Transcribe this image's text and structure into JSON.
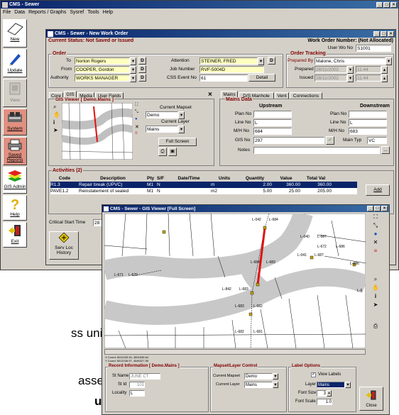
{
  "app": {
    "title": "CMS - Sewer",
    "menu": [
      "File",
      "Data",
      "Reports / Graphs",
      "Sysref",
      "Tools",
      "Help"
    ],
    "window_buttons": [
      "_",
      "□",
      "×"
    ]
  },
  "nav": [
    {
      "label": "New",
      "icon": "blank-document-icon"
    },
    {
      "label": "Update",
      "icon": "pencil-icon"
    },
    {
      "label": "View",
      "icon": "view-icon"
    },
    {
      "label": "System",
      "icon": "system-icon"
    },
    {
      "label": "Saved Reports",
      "icon": "printer-icon"
    },
    {
      "label": "GIS Admin",
      "icon": "layers-icon"
    },
    {
      "label": "Help",
      "icon": "question-icon"
    },
    {
      "label": "Exit",
      "icon": "exit-door-icon"
    }
  ],
  "wo": {
    "title": "CMS - Sewer - New Work Order",
    "status": "Current Status: Not Saved or Issued",
    "number_label": "Work Order Number: (Not Allocated)",
    "userwo_label": "User Wo No",
    "userwo": "S1001",
    "order": {
      "title": "Order",
      "to_label": "To",
      "to": "Norton Rogers",
      "from_label": "From",
      "from": "COOPER, Gordon",
      "authority_label": "Authority",
      "authority": "WORKS MANAGER",
      "attention_label": "Attention",
      "attention": "STEINER, FRED",
      "job_label": "Job Number",
      "job": "RVF-5004D",
      "css_label": "CSS Event No",
      "css": "61",
      "detail": "Detail",
      "d": "D"
    },
    "tracking": {
      "title": "Order Tracking",
      "prepared_by_label": "Prepared By",
      "prepared_by": "Malone, Chris",
      "prepared_label": "Prepared",
      "prepared_date": "28/11/2002",
      "prepared_time": "11:44",
      "issued_label": "Issued",
      "issued_date": "28/11/2002",
      "issued_time": "11:44"
    },
    "left_tabs": [
      "Core",
      "GIS",
      "Media",
      "User Fields"
    ],
    "gis": {
      "title": "GIS Viewer [ Demo.Mains ]",
      "mapset_label": "Current Mapset",
      "mapset": "Demo",
      "layer_label": "Current Layer",
      "layer": "Mains",
      "fullscreen": "Full Screen"
    },
    "right_tabs": [
      "Mains",
      "D/S Manhole",
      "Vent",
      "Connections"
    ],
    "mains": {
      "title": "Mains Data",
      "upstream": "Upstream",
      "downstream": "Downstream",
      "plan_label": "Plan No",
      "line_label": "Line No",
      "line_up": "L",
      "line_down": "L",
      "mh_label": "M/H No",
      "mh_up": "684",
      "mh_down": "683",
      "gis_label": "GIS No",
      "gis": "297",
      "maintype_label": "Main Typ",
      "maintype": "VC",
      "notes_label": "Notes",
      "notes_btn": "..."
    },
    "activities": {
      "title": "Activities (2)",
      "headers": [
        "Code",
        "Description",
        "Pty",
        "S/F",
        "Date/Time",
        "Units",
        "Quantity",
        "Value",
        "Total Val"
      ],
      "rows": [
        [
          "R1.3",
          "Repair break (UPVC)",
          "M1",
          "N",
          "",
          "m",
          "2.00",
          "360.00",
          "360.00"
        ],
        [
          "PAVE1.2",
          "Reinstatement of sealed",
          "M1",
          "N",
          "",
          "m2",
          "5.00",
          "25.00",
          "205.00"
        ]
      ],
      "add": "Add"
    },
    "critical_label": "Critical Start Time",
    "critical": "28",
    "servloc": "Serv Loc History"
  },
  "fs": {
    "title": "CMS - Sewer - GIS Viewer [Full Screen]",
    "coords": "X Coord: 6011033.34, 4551835.64\nY Coord: 6011036.97, 4546327.55",
    "labels": {
      "top1": "L-042",
      "top2": "L-684",
      "mid1": "L-684",
      "mid2": "L-683",
      "left1": "L-671",
      "left2": "L-670",
      "r1": "L-040",
      "r2": "L-687",
      "r3": "L-672",
      "r4": "L-686",
      "r5": "L-041",
      "r6": "L-687",
      "r7": "L-686",
      "r8": "L-6",
      "c1": "L-842",
      "c2": "L-683",
      "b1": "L-683",
      "b2": "L-682",
      "bb1": "L-682",
      "bb2": "L-681"
    },
    "record": {
      "title": "Record Information [ Demo.Mains ]",
      "st_name_label": "St Name",
      "st_name": "JUNE CT",
      "st_id_label": "St Id",
      "st_id": "101",
      "locality_label": "Locality",
      "locality": "L"
    },
    "mapset": {
      "title": "Mapset/Layer Control",
      "mapset_label": "Current Mapset",
      "mapset": "Demo",
      "layer_label": "Current Layer",
      "layer": "Mains"
    },
    "labelopts": {
      "title": "Label Options",
      "view_labels": "View Labels",
      "layer_label": "Layer",
      "layer": "Mains",
      "font_size_label": "Font Size",
      "font_size": "3",
      "font_scale_label": "Font Scale",
      "font_scale": "1.0"
    },
    "close": "Close"
  },
  "bg_text": {
    "line1": "ss units,",
    "line2": "assets",
    "line3": "us)"
  }
}
